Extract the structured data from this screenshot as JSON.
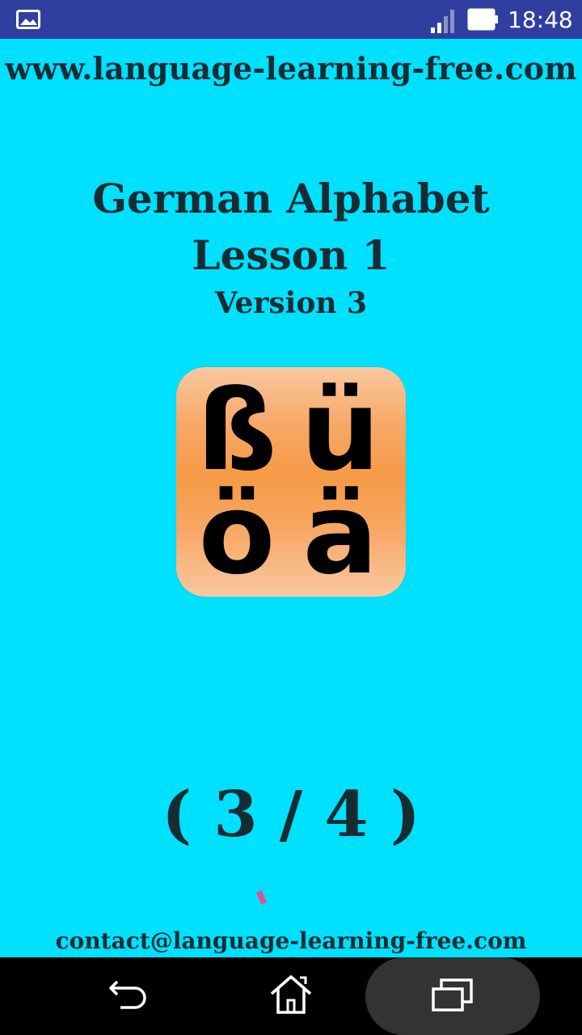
{
  "status_bar": {
    "time": "18:48",
    "icons": [
      "gallery-icon",
      "signal-icon",
      "battery-icon"
    ]
  },
  "header": {
    "site_url": "www.language-learning-free.com"
  },
  "lesson": {
    "title": "German Alphabet",
    "subtitle": "Lesson 1",
    "version": "Version 3"
  },
  "logo": {
    "letters": [
      "ß",
      "ü",
      "ö",
      "ä"
    ],
    "colors": {
      "light": "#f9c8a0",
      "dark": "#f59a45"
    }
  },
  "progress": {
    "label": "( 3 / 4 )",
    "current": 3,
    "total": 4
  },
  "footer": {
    "contact": "contact@language-learning-free.com"
  },
  "nav_bar": {
    "buttons": [
      "back-icon",
      "home-icon",
      "recents-icon"
    ]
  },
  "colors": {
    "background": "#00e0ff",
    "status_bar": "#303f9f",
    "text": "#152c33",
    "nav_bar": "#000000"
  }
}
